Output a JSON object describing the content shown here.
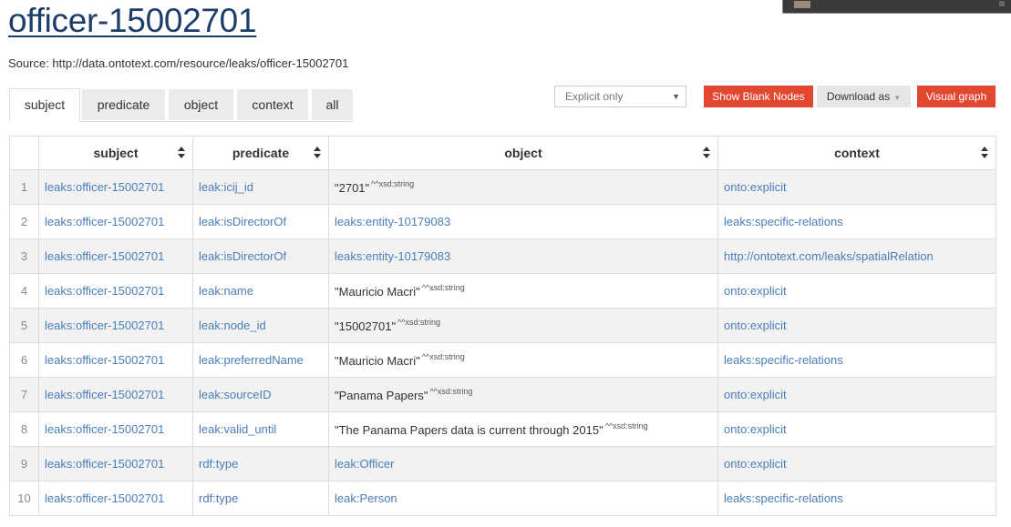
{
  "page": {
    "title": "officer-15002701",
    "source": "Source: http://data.ontotext.com/resource/leaks/officer-15002701"
  },
  "tabs": [
    {
      "label": "subject",
      "active": true
    },
    {
      "label": "predicate",
      "active": false
    },
    {
      "label": "object",
      "active": false
    },
    {
      "label": "context",
      "active": false
    },
    {
      "label": "all",
      "active": false
    }
  ],
  "toolbar": {
    "filter_value": "Explicit only",
    "show_blank_nodes": "Show Blank Nodes",
    "download_as": "Download as",
    "visual_graph": "Visual graph"
  },
  "colors": {
    "accent_red": "#e2482f",
    "link_blue": "#4a7db8",
    "title_blue": "#1d3e6b"
  },
  "table": {
    "columns": [
      "subject",
      "predicate",
      "object",
      "context"
    ],
    "rows": [
      {
        "n": "1",
        "subject": "leaks:officer-15002701",
        "predicate": "leak:icij_id",
        "object": "\"2701\"",
        "object_type": "^^xsd:string",
        "object_link": false,
        "context": "onto:explicit"
      },
      {
        "n": "2",
        "subject": "leaks:officer-15002701",
        "predicate": "leak:isDirectorOf",
        "object": "leaks:entity-10179083",
        "object_type": "",
        "object_link": true,
        "context": "leaks:specific-relations"
      },
      {
        "n": "3",
        "subject": "leaks:officer-15002701",
        "predicate": "leak:isDirectorOf",
        "object": "leaks:entity-10179083",
        "object_type": "",
        "object_link": true,
        "context": "http://ontotext.com/leaks/spatialRelation"
      },
      {
        "n": "4",
        "subject": "leaks:officer-15002701",
        "predicate": "leak:name",
        "object": "\"Mauricio Macri\"",
        "object_type": "^^xsd:string",
        "object_link": false,
        "context": "onto:explicit"
      },
      {
        "n": "5",
        "subject": "leaks:officer-15002701",
        "predicate": "leak:node_id",
        "object": "\"15002701\"",
        "object_type": "^^xsd:string",
        "object_link": false,
        "context": "onto:explicit"
      },
      {
        "n": "6",
        "subject": "leaks:officer-15002701",
        "predicate": "leak:preferredName",
        "object": "\"Mauricio Macri\"",
        "object_type": "^^xsd:string",
        "object_link": false,
        "context": "leaks:specific-relations"
      },
      {
        "n": "7",
        "subject": "leaks:officer-15002701",
        "predicate": "leak:sourceID",
        "object": "\"Panama Papers\"",
        "object_type": "^^xsd:string",
        "object_link": false,
        "context": "onto:explicit"
      },
      {
        "n": "8",
        "subject": "leaks:officer-15002701",
        "predicate": "leak:valid_until",
        "object": "\"The Panama Papers data is current through 2015\"",
        "object_type": "^^xsd:string",
        "object_link": false,
        "context": "onto:explicit"
      },
      {
        "n": "9",
        "subject": "leaks:officer-15002701",
        "predicate": "rdf:type",
        "object": "leak:Officer",
        "object_type": "",
        "object_link": true,
        "context": "onto:explicit"
      },
      {
        "n": "10",
        "subject": "leaks:officer-15002701",
        "predicate": "rdf:type",
        "object": "leak:Person",
        "object_type": "",
        "object_link": true,
        "context": "leaks:specific-relations"
      }
    ]
  }
}
